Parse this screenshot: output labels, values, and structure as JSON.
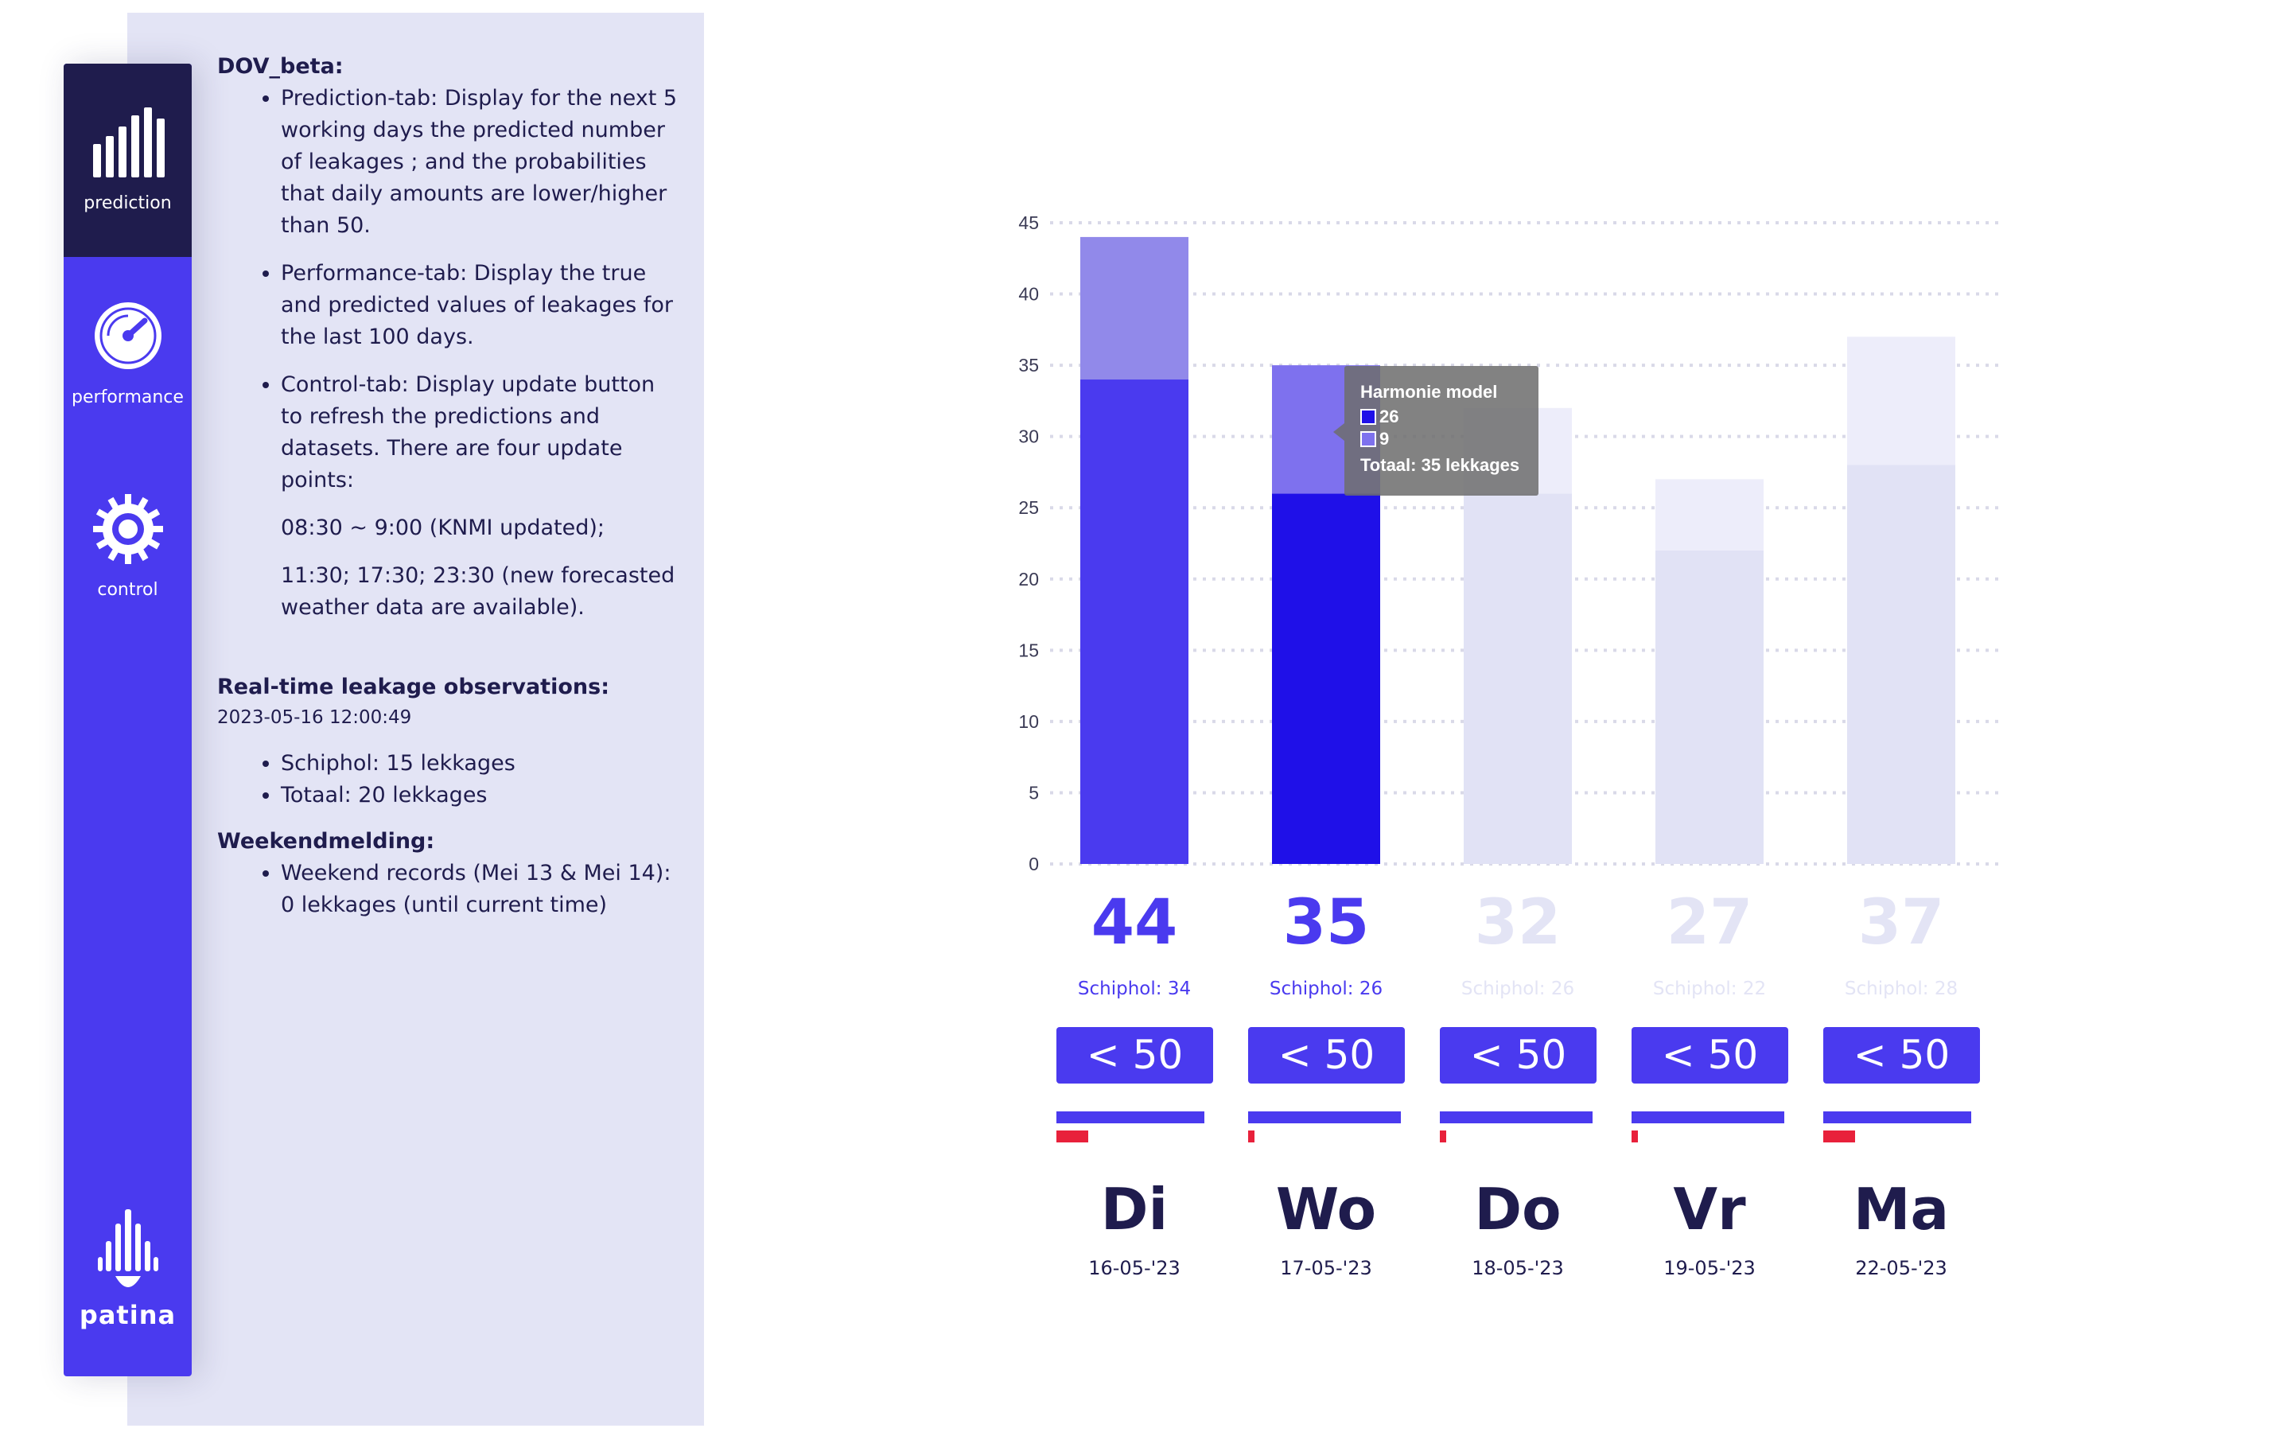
{
  "nav": {
    "items": [
      {
        "label": "prediction",
        "icon": "bar-chart-icon",
        "active": true
      },
      {
        "label": "performance",
        "icon": "gauge-icon",
        "active": false
      },
      {
        "label": "control",
        "icon": "gear-icon",
        "active": false
      }
    ],
    "logo_text": "patina"
  },
  "info": {
    "title": "DOV_beta:",
    "bullets": [
      "Prediction-tab: Display for the next 5 working days the predicted number of leakages ; and the probabilities that daily amounts are lower/higher than 50.",
      "Performance-tab: Display the true and predicted values of leakages for the last 100 days.",
      "Control-tab: Display update button to refresh the predictions and datasets. There are four update points:"
    ],
    "update_points": [
      "08:30 ~ 9:00 (KNMI updated);",
      "11:30; 17:30; 23:30 (new forecasted weather data are available)."
    ],
    "realtime_title": "Real-time leakage observations:",
    "realtime_timestamp": "2023-05-16 12:00:49",
    "realtime_items": [
      "Schiphol: 15 lekkages",
      "Totaal: 20 lekkages"
    ],
    "weekend_title": "Weekendmelding:",
    "weekend_items": [
      "Weekend records (Mei 13 & Mei 14): 0 lekkages (until current time)"
    ]
  },
  "tooltip": {
    "title": "Harmonie model",
    "rows": [
      "26",
      "9"
    ],
    "total": "Totaal: 35 lekkages"
  },
  "days": [
    {
      "name": "Di",
      "date": "16-05-'23",
      "total": "44",
      "schiphol": "Schiphol: 34",
      "badge": "< 50",
      "p_low": 0.97,
      "p_high": 0.05,
      "active": true
    },
    {
      "name": "Wo",
      "date": "17-05-'23",
      "total": "35",
      "schiphol": "Schiphol: 26",
      "badge": "< 50",
      "p_low": 1.0,
      "p_high": 0.01,
      "active": true
    },
    {
      "name": "Do",
      "date": "18-05-'23",
      "total": "32",
      "schiphol": "Schiphol: 26",
      "badge": "< 50",
      "p_low": 1.0,
      "p_high": 0.01,
      "active": false
    },
    {
      "name": "Vr",
      "date": "19-05-'23",
      "total": "27",
      "schiphol": "Schiphol: 22",
      "badge": "< 50",
      "p_low": 1.0,
      "p_high": 0.01,
      "active": false
    },
    {
      "name": "Ma",
      "date": "22-05-'23",
      "total": "37",
      "schiphol": "Schiphol: 28",
      "badge": "< 50",
      "p_low": 0.97,
      "p_high": 0.05,
      "active": false
    }
  ],
  "chart_data": {
    "type": "bar",
    "stacked": true,
    "categories": [
      "Di",
      "Wo",
      "Do",
      "Vr",
      "Ma"
    ],
    "series": [
      {
        "values": [
          34,
          26,
          26,
          22,
          28
        ]
      },
      {
        "values": [
          10,
          9,
          6,
          5,
          9
        ]
      }
    ],
    "ylim": [
      0,
      45
    ],
    "yticks": [
      "0",
      "5",
      "10",
      "15",
      "20",
      "25",
      "30",
      "35",
      "40",
      "45"
    ],
    "grid": true,
    "colors": {
      "active_bottom": [
        "#4a3aef",
        "#1f10e8"
      ],
      "active_top": [
        "#9189ea",
        "#7e71ee"
      ],
      "inactive_bottom": "#e1e2f5",
      "inactive_top": "#ededfa"
    }
  },
  "colors": {
    "accent": "#4a3aef",
    "dark": "#1f1c4d",
    "panel_bg": "#e3e4f5",
    "muted": "#e3e4f5",
    "danger": "#e8213b"
  }
}
